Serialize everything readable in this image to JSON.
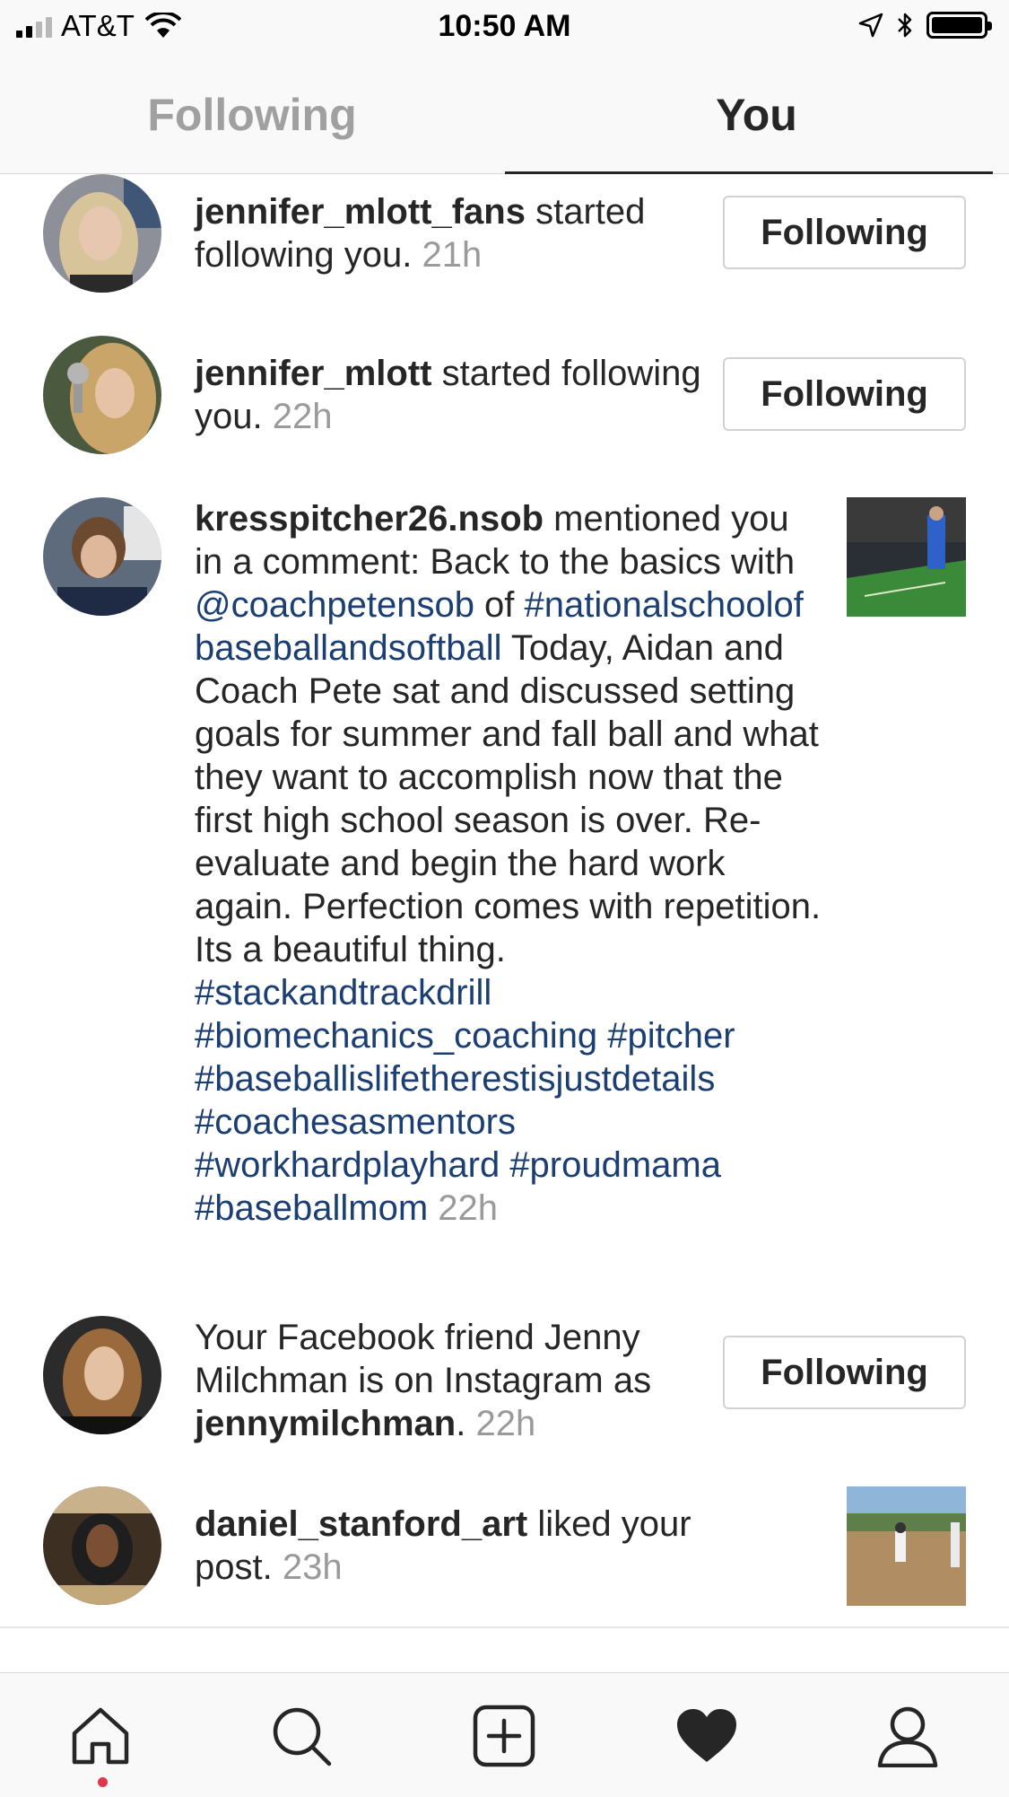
{
  "status_bar": {
    "carrier": "AT&T",
    "time": "10:50 AM"
  },
  "tabs": {
    "following": "Following",
    "you": "You"
  },
  "notifications": [
    {
      "username": "jennifer_mlott_fans",
      "action": " started following you.",
      "time": "21h",
      "button": "Following"
    },
    {
      "username": "jennifer_mlott",
      "action": " started following you.",
      "time": "22h",
      "button": "Following"
    },
    {
      "username": "kresspitcher26.nsob",
      "action_1": " mentioned you in a comment: Back to the basics with ",
      "mention": "@coachpetensob",
      "action_2": " of ",
      "hashtag_1": "#nationalschoolofbaseballandsoftball",
      "body": " Today, Aidan and Coach Pete sat and discussed setting goals for summer and fall ball and what they want to accomplish now that the first high school season is over. Re-evaluate and begin the hard work again. Perfection comes with repetition. Its a beautiful thing.",
      "hashtags": "#stackandtrackdrill #biomechanics_coaching #pitcher #baseballislifetherestisjustdetails #coachesasmentors #workhardplayhard #proudmama #baseballmom",
      "time": "22h"
    },
    {
      "prefix": "Your Facebook friend Jenny Milchman is on Instagram as ",
      "username": "jennymilchman",
      "suffix": ".",
      "time": "22h",
      "button": "Following"
    },
    {
      "username": "daniel_stanford_art",
      "action": " liked your post.",
      "time": "23h"
    }
  ],
  "colors": {
    "link": "#1b3e73",
    "timestamp": "#9a9a9a",
    "text": "#262626",
    "notification_dot": "#e0384a"
  },
  "nav_icons": [
    "home-icon",
    "search-icon",
    "add-post-icon",
    "heart-icon",
    "profile-icon"
  ]
}
